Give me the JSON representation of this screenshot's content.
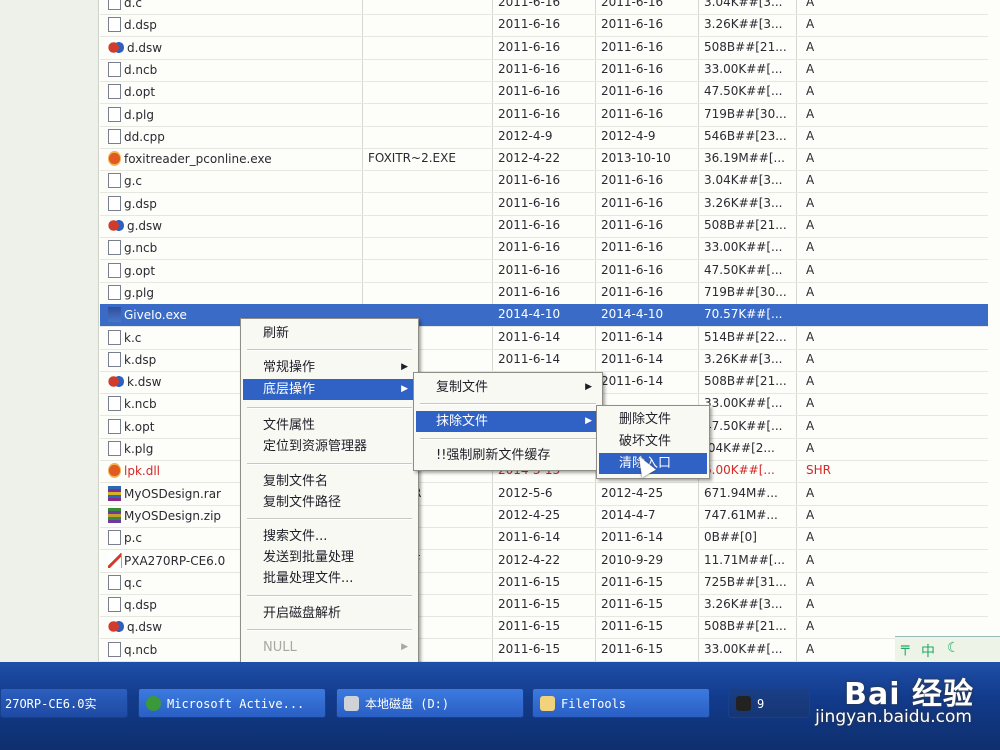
{
  "file_rows": [
    {
      "icon": "file-icon",
      "name": "d.c",
      "short": "",
      "created": "2011-6-16",
      "modified": "2011-6-16",
      "size": "3.04K##[3...",
      "attr": "A"
    },
    {
      "icon": "file-icon",
      "name": "d.dsp",
      "short": "",
      "created": "2011-6-16",
      "modified": "2011-6-16",
      "size": "3.26K##[3...",
      "attr": "A"
    },
    {
      "icon": "workspace-icon",
      "name": "d.dsw",
      "short": "",
      "created": "2011-6-16",
      "modified": "2011-6-16",
      "size": "508B##[21...",
      "attr": "A"
    },
    {
      "icon": "file-icon",
      "name": "d.ncb",
      "short": "",
      "created": "2011-6-16",
      "modified": "2011-6-16",
      "size": "33.00K##[...",
      "attr": "A"
    },
    {
      "icon": "file-icon",
      "name": "d.opt",
      "short": "",
      "created": "2011-6-16",
      "modified": "2011-6-16",
      "size": "47.50K##[...",
      "attr": "A"
    },
    {
      "icon": "file-icon",
      "name": "d.plg",
      "short": "",
      "created": "2011-6-16",
      "modified": "2011-6-16",
      "size": "719B##[30...",
      "attr": "A"
    },
    {
      "icon": "file-icon",
      "name": "dd.cpp",
      "short": "",
      "created": "2012-4-9",
      "modified": "2012-4-9",
      "size": "546B##[23...",
      "attr": "A"
    },
    {
      "icon": "exe-icon",
      "name": "foxitreader_pconline.exe",
      "short": "FOXITR~2.EXE",
      "created": "2012-4-22",
      "modified": "2013-10-10",
      "size": "36.19M##[...",
      "attr": "A"
    },
    {
      "icon": "file-icon",
      "name": "g.c",
      "short": "",
      "created": "2011-6-16",
      "modified": "2011-6-16",
      "size": "3.04K##[3...",
      "attr": "A"
    },
    {
      "icon": "file-icon",
      "name": "g.dsp",
      "short": "",
      "created": "2011-6-16",
      "modified": "2011-6-16",
      "size": "3.26K##[3...",
      "attr": "A"
    },
    {
      "icon": "workspace-icon",
      "name": "g.dsw",
      "short": "",
      "created": "2011-6-16",
      "modified": "2011-6-16",
      "size": "508B##[21...",
      "attr": "A"
    },
    {
      "icon": "file-icon",
      "name": "g.ncb",
      "short": "",
      "created": "2011-6-16",
      "modified": "2011-6-16",
      "size": "33.00K##[...",
      "attr": "A"
    },
    {
      "icon": "file-icon",
      "name": "g.opt",
      "short": "",
      "created": "2011-6-16",
      "modified": "2011-6-16",
      "size": "47.50K##[...",
      "attr": "A"
    },
    {
      "icon": "file-icon",
      "name": "g.plg",
      "short": "",
      "created": "2011-6-16",
      "modified": "2011-6-16",
      "size": "719B##[30...",
      "attr": "A"
    },
    {
      "icon": "window-icon",
      "name": "GiveIo.exe",
      "short": "",
      "created": "2014-4-10",
      "modified": "2014-4-10",
      "size": "70.57K##[...",
      "attr": "",
      "selected": true
    },
    {
      "icon": "file-icon",
      "name": "k.c",
      "short": "",
      "created": "2011-6-14",
      "modified": "2011-6-14",
      "size": "514B##[22...",
      "attr": "A"
    },
    {
      "icon": "file-icon",
      "name": "k.dsp",
      "short": "",
      "created": "2011-6-14",
      "modified": "2011-6-14",
      "size": "3.26K##[3...",
      "attr": "A"
    },
    {
      "icon": "workspace-icon",
      "name": "k.dsw",
      "short": "",
      "created": "2011-6-14",
      "modified": "2011-6-14",
      "size": "508B##[21...",
      "attr": "A"
    },
    {
      "icon": "file-icon",
      "name": "k.ncb",
      "short": "",
      "created": "",
      "modified": "",
      "size": "33.00K##[...",
      "attr": "A"
    },
    {
      "icon": "file-icon",
      "name": "k.opt",
      "short": "",
      "created": "",
      "modified": "",
      "size": "47.50K##[...",
      "attr": "A"
    },
    {
      "icon": "file-icon",
      "name": "k.plg",
      "short": "",
      "created": "",
      "modified": "",
      "size": ".04K##[2...",
      "attr": "A"
    },
    {
      "icon": "exe-icon",
      "name": "lpk.dll",
      "short": "",
      "created": "2014-3-13",
      "modified": "",
      "size": "6.00K##[...",
      "attr": "SHR",
      "red": true
    },
    {
      "icon": "rar-icon",
      "name": "MyOSDesign.rar",
      "short": "E~1.RAR",
      "created": "2012-5-6",
      "modified": "2012-4-25",
      "size": "671.94M#...",
      "attr": "A"
    },
    {
      "icon": "zip-icon",
      "name": "MyOSDesign.zip",
      "short": "E~1.ZIP",
      "created": "2012-4-25",
      "modified": "2014-4-7",
      "size": "747.61M#...",
      "attr": "A"
    },
    {
      "icon": "file-icon",
      "name": "p.c",
      "short": "",
      "created": "2011-6-14",
      "modified": "2011-6-14",
      "size": "0B##[0]",
      "attr": "A"
    },
    {
      "icon": "pdf-icon",
      "name": "PXA270RP-CE6.0",
      "short": "3~1.PDF",
      "created": "2012-4-22",
      "modified": "2010-9-29",
      "size": "11.71M##[...",
      "attr": "A"
    },
    {
      "icon": "file-icon",
      "name": "q.c",
      "short": "",
      "created": "2011-6-15",
      "modified": "2011-6-15",
      "size": "725B##[31...",
      "attr": "A"
    },
    {
      "icon": "file-icon",
      "name": "q.dsp",
      "short": "",
      "created": "2011-6-15",
      "modified": "2011-6-15",
      "size": "3.26K##[3...",
      "attr": "A"
    },
    {
      "icon": "workspace-icon",
      "name": "q.dsw",
      "short": "",
      "created": "2011-6-15",
      "modified": "2011-6-15",
      "size": "508B##[21...",
      "attr": "A"
    },
    {
      "icon": "file-icon",
      "name": "q.ncb",
      "short": "",
      "created": "2011-6-15",
      "modified": "2011-6-15",
      "size": "33.00K##[...",
      "attr": "A"
    }
  ],
  "context_menu": {
    "items": [
      "刷新",
      "常规操作",
      "底层操作",
      "文件属性",
      "定位到资源管理器",
      "复制文件名",
      "复制文件路径",
      "搜索文件...",
      "发送到批量处理",
      "批量处理文件...",
      "开启磁盘解析",
      "NULL"
    ]
  },
  "submenu_lowlevel": {
    "items": [
      "复制文件",
      "抹除文件",
      "!!强制刷新文件缓存"
    ]
  },
  "submenu_erase": {
    "items": [
      "删除文件",
      "破坏文件",
      "清除入口"
    ]
  },
  "taskbar": {
    "items": [
      "27ORP-CE6.0实",
      "Microsoft Active...",
      "本地磁盘 (D:)",
      "FileTools",
      "9"
    ]
  },
  "tray": {
    "text": "中"
  },
  "watermark": {
    "logo": "Bai 经验",
    "url": "jingyan.baidu.com"
  }
}
